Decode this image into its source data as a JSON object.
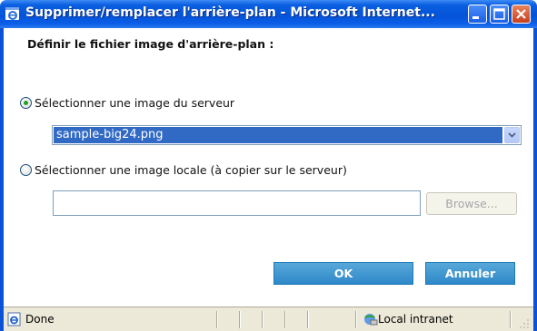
{
  "window": {
    "title": "Supprimer/remplacer l'arrière-plan - Microsoft Internet...",
    "title_icon": "ie-icon",
    "controls": [
      "minimize-icon",
      "maximize-icon",
      "close-icon"
    ]
  },
  "dialog": {
    "heading": "Définir le fichier image d'arrière-plan :",
    "option_server": {
      "label": "Sélectionner une image du serveur",
      "checked": true
    },
    "server_select": {
      "selected": "sample-big24.png"
    },
    "option_local": {
      "label": "Sélectionner une image locale (à copier sur le serveur)",
      "checked": false
    },
    "file_input": {
      "value": ""
    },
    "browse_label": "Browse...",
    "ok_label": "OK",
    "cancel_label": "Annuler"
  },
  "statusbar": {
    "status": "Done",
    "zone": "Local intranet"
  },
  "colors": {
    "titlebar": "#0453d8",
    "selection": "#316ac5",
    "action_button": "#2e88c8",
    "statusbar": "#ece9d8"
  }
}
